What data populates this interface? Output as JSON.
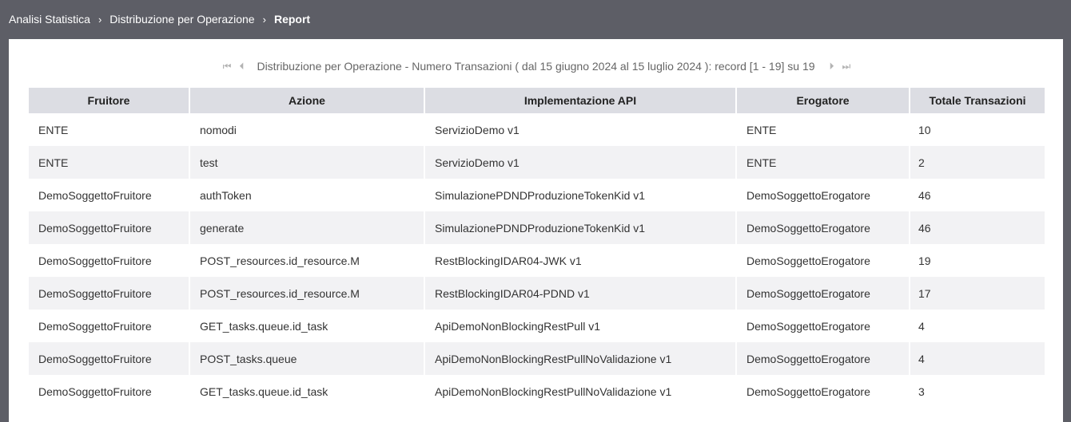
{
  "breadcrumb": {
    "items": [
      "Analisi Statistica",
      "Distribuzione per Operazione"
    ],
    "current": "Report",
    "separator": "›"
  },
  "pager": {
    "first_icon": "⏮",
    "prev_icon": "⏴",
    "next_icon": "⏵",
    "last_icon": "⏭",
    "text": "Distribuzione per Operazione - Numero Transazioni ( dal 15 giugno 2024 al 15 luglio 2024 ): record [1 - 19] su 19"
  },
  "table": {
    "headers": [
      "Fruitore",
      "Azione",
      "Implementazione API",
      "Erogatore",
      "Totale Transazioni"
    ],
    "rows": [
      [
        "ENTE",
        "nomodi",
        "ServizioDemo v1",
        "ENTE",
        "10"
      ],
      [
        "ENTE",
        "test",
        "ServizioDemo v1",
        "ENTE",
        "2"
      ],
      [
        "DemoSoggettoFruitore",
        "authToken",
        "SimulazionePDNDProduzioneTokenKid v1",
        "DemoSoggettoErogatore",
        "46"
      ],
      [
        "DemoSoggettoFruitore",
        "generate",
        "SimulazionePDNDProduzioneTokenKid v1",
        "DemoSoggettoErogatore",
        "46"
      ],
      [
        "DemoSoggettoFruitore",
        "POST_resources.id_resource.M",
        "RestBlockingIDAR04-JWK v1",
        "DemoSoggettoErogatore",
        "19"
      ],
      [
        "DemoSoggettoFruitore",
        "POST_resources.id_resource.M",
        "RestBlockingIDAR04-PDND v1",
        "DemoSoggettoErogatore",
        "17"
      ],
      [
        "DemoSoggettoFruitore",
        "GET_tasks.queue.id_task",
        "ApiDemoNonBlockingRestPull v1",
        "DemoSoggettoErogatore",
        "4"
      ],
      [
        "DemoSoggettoFruitore",
        "POST_tasks.queue",
        "ApiDemoNonBlockingRestPullNoValidazione v1",
        "DemoSoggettoErogatore",
        "4"
      ],
      [
        "DemoSoggettoFruitore",
        "GET_tasks.queue.id_task",
        "ApiDemoNonBlockingRestPullNoValidazione v1",
        "DemoSoggettoErogatore",
        "3"
      ]
    ]
  },
  "colors": {
    "topbar": "#5d5e66",
    "header_bg": "#dcdde3",
    "row_alt": "#f2f2f4"
  }
}
